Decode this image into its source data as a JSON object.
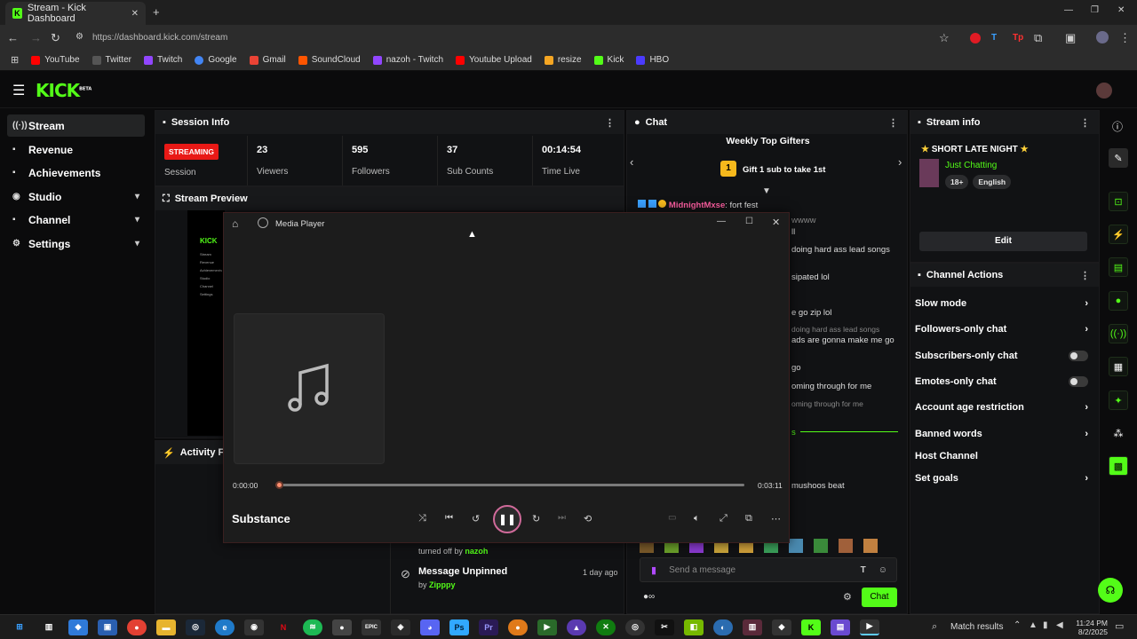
{
  "browser": {
    "tab_title": "Stream - Kick Dashboard",
    "url": "https://dashboard.kick.com/stream",
    "bookmarks": [
      {
        "label": "YouTube",
        "color": "#ff0000"
      },
      {
        "label": "Twitter",
        "color": "#000000"
      },
      {
        "label": "Twitch",
        "color": "#9146ff"
      },
      {
        "label": "Google",
        "color": "#4285f4"
      },
      {
        "label": "Gmail",
        "color": "#ea4335"
      },
      {
        "label": "SoundCloud",
        "color": "#ff5500"
      },
      {
        "label": "nazoh - Twitch",
        "color": "#9146ff"
      },
      {
        "label": "Youtube Upload",
        "color": "#ff0000"
      },
      {
        "label": "resize",
        "color": "#f5a623"
      },
      {
        "label": "Kick",
        "color": "#53fc18"
      },
      {
        "label": "HBO",
        "color": "#4b3bff"
      }
    ]
  },
  "brand": {
    "logo": "KICK",
    "beta": "BETA",
    "accent": "#53fc18"
  },
  "sidebar": {
    "items": [
      {
        "label": "Stream",
        "icon": "broadcast-icon"
      },
      {
        "label": "Revenue",
        "icon": "wallet-icon"
      },
      {
        "label": "Achievements",
        "icon": "trophy-icon"
      },
      {
        "label": "Studio",
        "icon": "studio-icon"
      },
      {
        "label": "Channel",
        "icon": "channel-icon"
      },
      {
        "label": "Settings",
        "icon": "gear-icon"
      }
    ]
  },
  "session": {
    "title": "Session Info",
    "badge": "STREAMING",
    "session_label": "Session",
    "stats": [
      {
        "value": "23",
        "label": "Viewers"
      },
      {
        "value": "595",
        "label": "Followers"
      },
      {
        "value": "37",
        "label": "Sub Counts"
      },
      {
        "value": "00:14:54",
        "label": "Time Live"
      }
    ]
  },
  "preview": {
    "title": "Stream Preview",
    "mini_items": [
      "Stream",
      "Revenue",
      "Achievements",
      "Studio",
      "Channel",
      "Settings"
    ]
  },
  "activity": {
    "title": "Activity Feed",
    "items": [
      {
        "text": "turned off by",
        "user": "nazoh"
      },
      {
        "title": "Message Unpinned",
        "by": "by",
        "user": "Zipppy",
        "time": "1 day ago"
      }
    ]
  },
  "chat": {
    "title": "Chat",
    "top_gifters": "Weekly Top Gifters",
    "gift_cta": "Gift 1 sub to take 1st",
    "gift_rank": "1",
    "first_user": "MidnightMxse",
    "first_msg": ": fort fest",
    "partial": [
      "wwww",
      "ll",
      "doing hard ass lead songs",
      "sipated lol",
      "e go zip lol",
      "doing hard ass lead songs",
      "ads are gonna make me go",
      "go",
      "oming through for me",
      "oming through for me",
      "s",
      "mushoos beat"
    ],
    "placeholder": "Send a message",
    "send": "Chat"
  },
  "stream_info": {
    "title": "Stream info",
    "stream_title": "SHORT LATE NIGHT",
    "category": "Just Chatting",
    "tags": [
      "18+",
      "English"
    ],
    "edit": "Edit"
  },
  "channel_actions": {
    "title": "Channel Actions",
    "items": [
      {
        "label": "Slow mode",
        "control": "chevron"
      },
      {
        "label": "Followers-only chat",
        "control": "chevron"
      },
      {
        "label": "Subscribers-only chat",
        "control": "toggle"
      },
      {
        "label": "Emotes-only chat",
        "control": "toggle"
      },
      {
        "label": "Account age restriction",
        "control": "chevron"
      },
      {
        "label": "Banned words",
        "control": "chevron"
      },
      {
        "label": "Host Channel",
        "control": "none"
      },
      {
        "label": "Set goals",
        "control": "chevron"
      }
    ]
  },
  "media_player": {
    "app": "Media Player",
    "track": "Substance",
    "elapsed": "0:00:00",
    "duration": "0:03:11",
    "progress": 0.0
  },
  "taskbar": {
    "search": "Match results",
    "time": "11:24 PM",
    "date": "8/2/2025"
  }
}
